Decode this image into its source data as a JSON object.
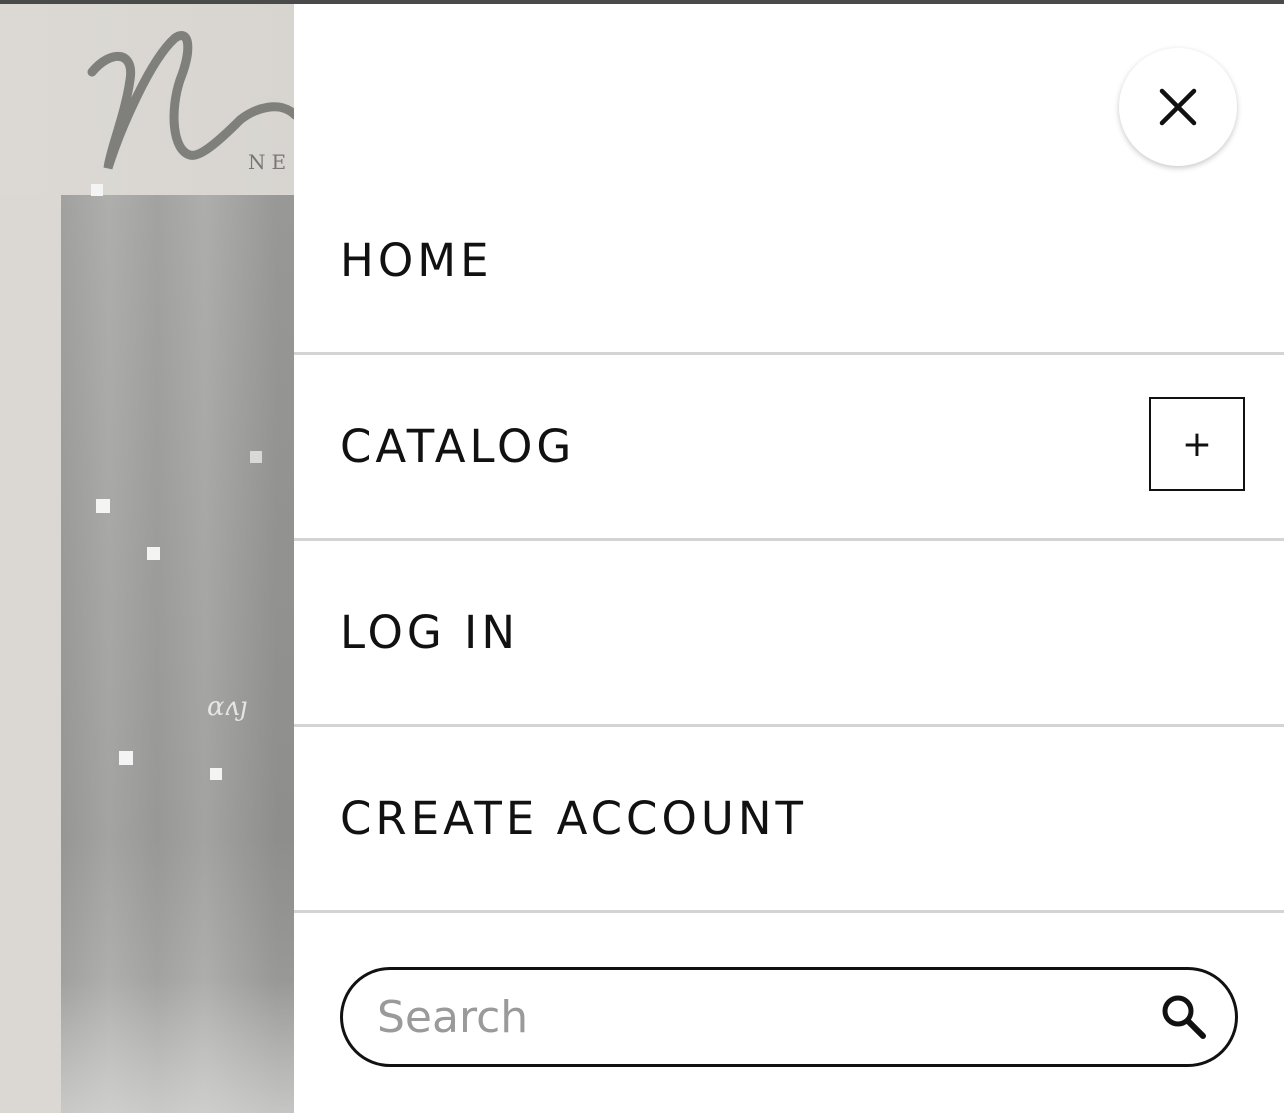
{
  "background_page": {
    "logo_text": "Ne",
    "logo_subtext": "NE"
  },
  "drawer": {
    "close_icon": "close-icon",
    "menu": [
      {
        "label": "HOME"
      },
      {
        "label": "CATALOG",
        "expand_icon": "plus-icon",
        "expand_symbol": "+"
      },
      {
        "label": "LOG IN"
      },
      {
        "label": "CREATE ACCOUNT"
      }
    ],
    "search": {
      "placeholder": "Search",
      "value": "",
      "icon": "search-icon"
    }
  },
  "colors": {
    "drawer_bg": "#ffffff",
    "text": "#111111",
    "divider": "#d4d4d4",
    "placeholder": "#9a9a9a",
    "top_bar": "#4a4a4a"
  }
}
